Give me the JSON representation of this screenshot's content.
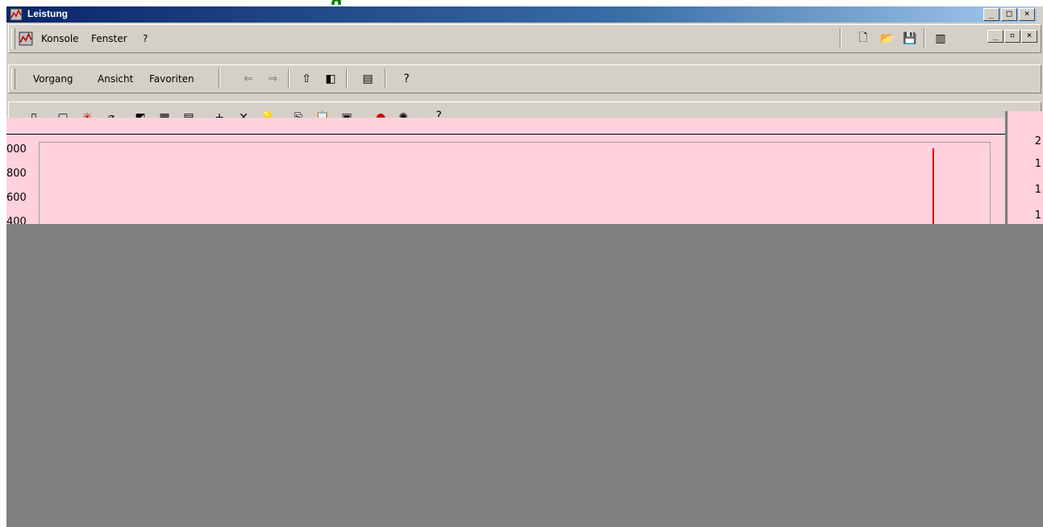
{
  "window": {
    "title": "Leistung"
  },
  "caption_buttons": [
    "_",
    "□",
    "×"
  ],
  "mdi_buttons": [
    "_",
    "▫",
    "×"
  ],
  "menubar": {
    "items": [
      "Konsole",
      "Fenster",
      "?"
    ]
  },
  "actionbar": {
    "items": [
      "Vorgang",
      "Ansicht",
      "Favoriten"
    ]
  },
  "chart": {
    "y_ticks_left": [
      "000",
      "800",
      "600",
      "400"
    ],
    "y_ticks_right": [
      "2",
      "1",
      "1",
      "1"
    ]
  },
  "fragment_text": "g",
  "colors": {
    "chart_bg": "#ffd1dc",
    "cursor_line": "#e00000",
    "title_start": "#0a246a"
  }
}
